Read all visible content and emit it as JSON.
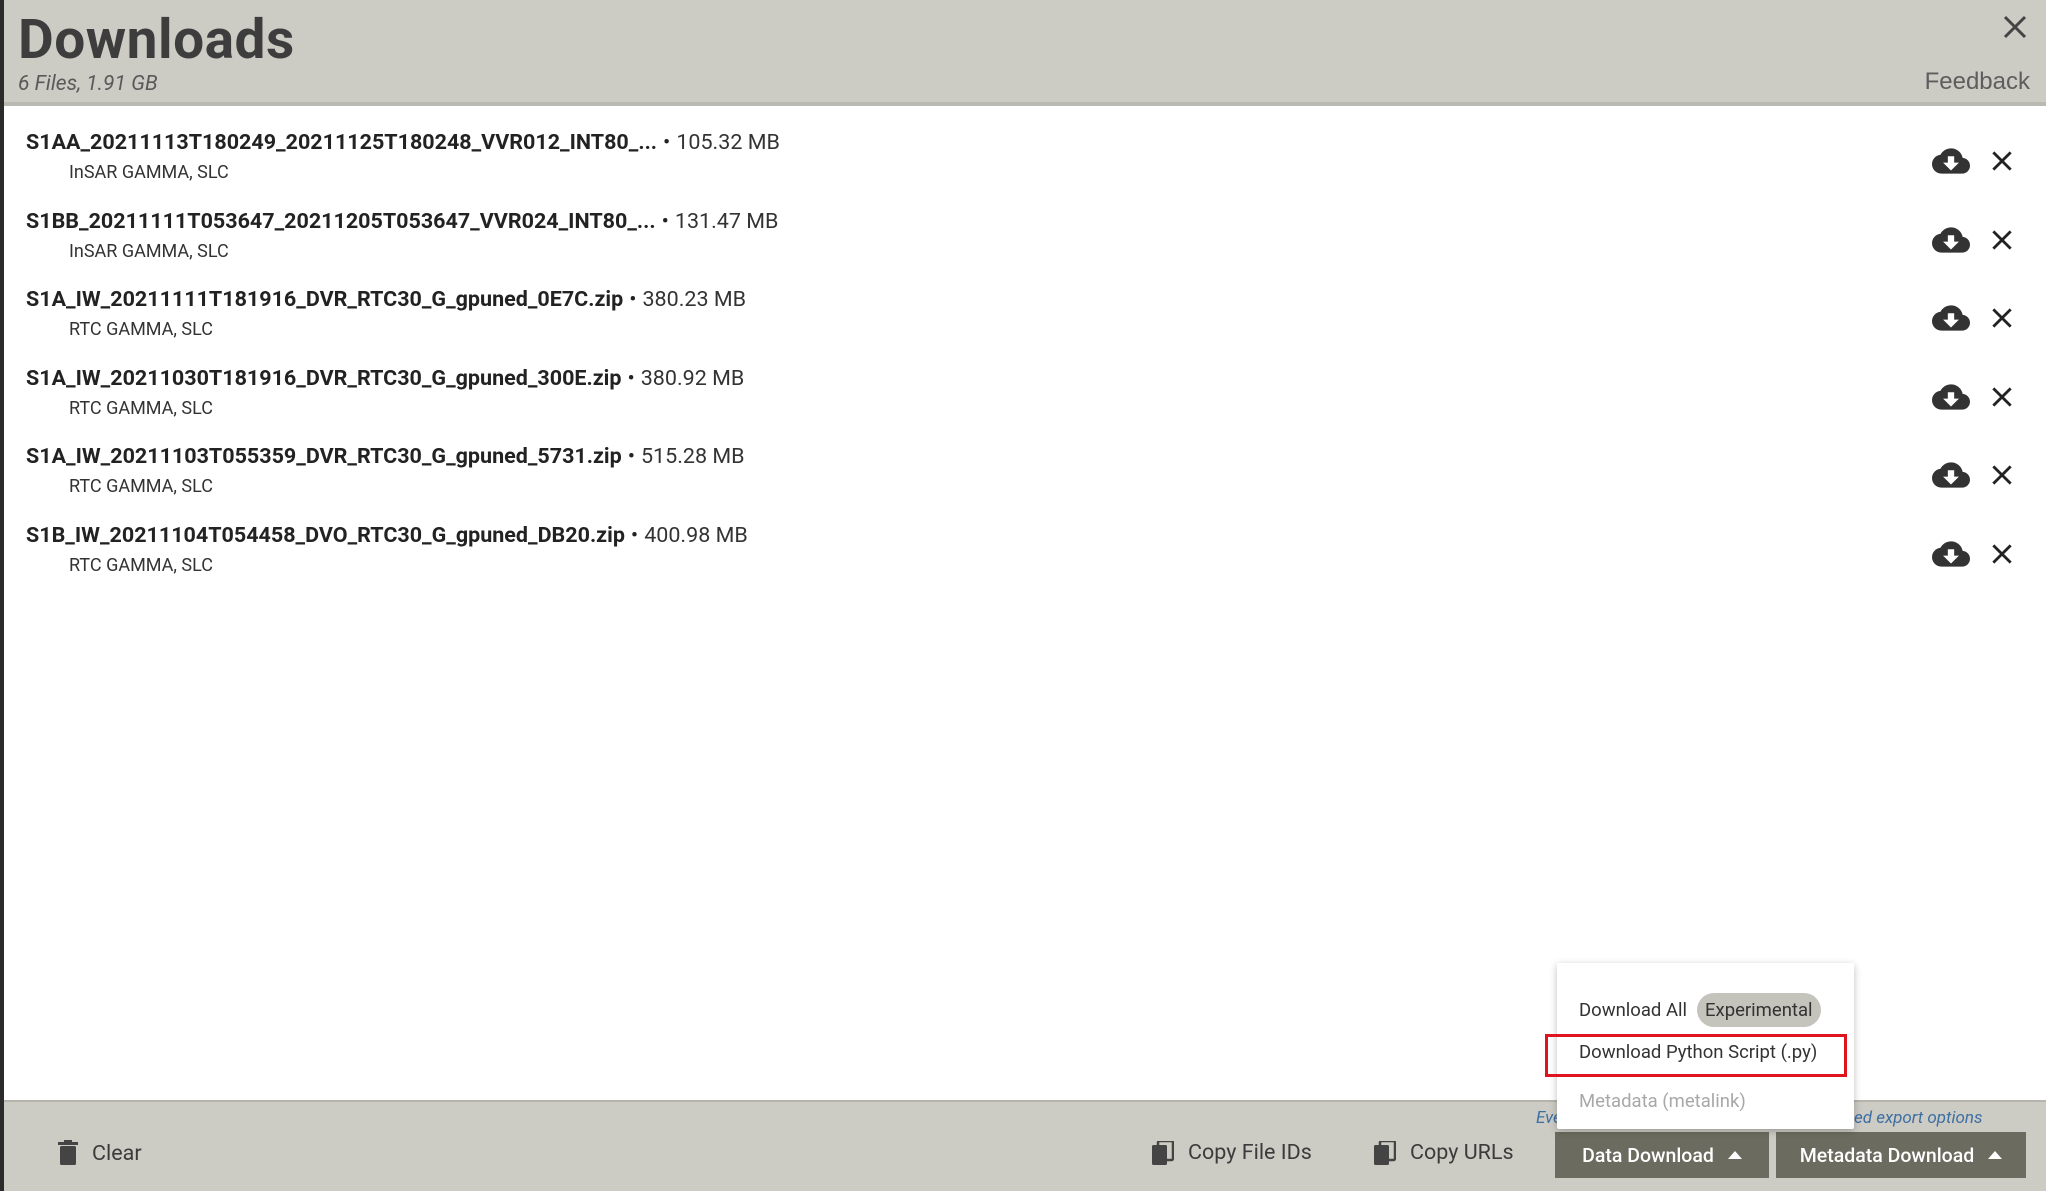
{
  "header": {
    "title": "Downloads",
    "subtitle": "6 Files, 1.91 GB",
    "feedback_label": "Feedback"
  },
  "files": [
    {
      "name": "S1AA_20211113T180249_20211125T180248_VVR012_INT80_...",
      "separator": "•",
      "size": "105.32 MB",
      "type": "InSAR GAMMA, SLC"
    },
    {
      "name": "S1BB_20211111T053647_20211205T053647_VVR024_INT80_...",
      "separator": "•",
      "size": "131.47 MB",
      "type": "InSAR GAMMA, SLC"
    },
    {
      "name": "S1A_IW_20211111T181916_DVR_RTC30_G_gpuned_0E7C.zip",
      "separator": "•",
      "size": "380.23 MB",
      "type": "RTC GAMMA, SLC"
    },
    {
      "name": "S1A_IW_20211030T181916_DVR_RTC30_G_gpuned_300E.zip",
      "separator": "•",
      "size": "380.92 MB",
      "type": "RTC GAMMA, SLC"
    },
    {
      "name": "S1A_IW_20211103T055359_DVR_RTC30_G_gpuned_5731.zip",
      "separator": "•",
      "size": "515.28 MB",
      "type": "RTC GAMMA, SLC"
    },
    {
      "name": "S1B_IW_20211104T054458_DVO_RTC30_G_gpuned_DB20.zip",
      "separator": "•",
      "size": "400.98 MB",
      "type": "RTC GAMMA, SLC"
    }
  ],
  "footer": {
    "clear_label": "Clear",
    "copy_ids_label": "Copy File IDs",
    "copy_urls_label": "Copy URLs",
    "data_download_label": "Data Download",
    "metadata_download_label": "Metadata Download",
    "export_hint_left": "Eve",
    "export_hint_right": "ed export options"
  },
  "menu": {
    "download_all_label": "Download All",
    "experimental_badge": "Experimental",
    "python_script_label": "Download Python Script (.py)",
    "metalink_label": "Metadata (metalink)"
  },
  "icons": {
    "close": "close-icon",
    "download": "cloud-download-icon",
    "remove": "close-icon",
    "trash": "trash-icon",
    "copy": "copy-icon",
    "caret": "caret-up-icon"
  },
  "colors": {
    "header_bg": "#cccbc4",
    "dark_button": "#6b6b5f",
    "highlight": "#e0141e",
    "link": "#3d6fa3"
  }
}
